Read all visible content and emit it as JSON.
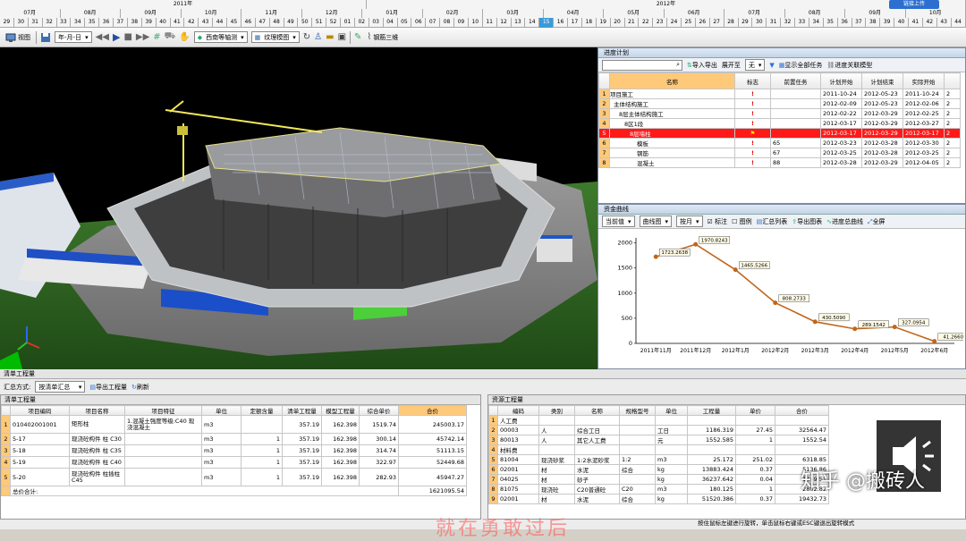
{
  "timeline": {
    "years": [
      {
        "label": "2011年"
      },
      {
        "label": "2012年"
      }
    ],
    "months": [
      "07月",
      "08月",
      "09月",
      "10月",
      "11月",
      "12月",
      "01月",
      "02月",
      "03月",
      "04月",
      "05月",
      "06月",
      "07月",
      "08月",
      "09月",
      "10月"
    ],
    "weeks": [
      "29",
      "30",
      "31",
      "32",
      "33",
      "34",
      "35",
      "36",
      "37",
      "38",
      "39",
      "40",
      "41",
      "42",
      "43",
      "44",
      "45",
      "46",
      "47",
      "48",
      "49",
      "50",
      "51",
      "52",
      "01",
      "02",
      "03",
      "04",
      "05",
      "06",
      "07",
      "08",
      "09",
      "10",
      "11",
      "12",
      "13",
      "14",
      "15",
      "16",
      "17",
      "18",
      "19",
      "20",
      "21",
      "22",
      "23",
      "24",
      "25",
      "26",
      "27",
      "28",
      "29",
      "30",
      "31",
      "32",
      "33",
      "34",
      "35",
      "36",
      "37",
      "38",
      "39",
      "40",
      "41",
      "42",
      "43",
      "44"
    ],
    "share_label": "链接上传"
  },
  "toolbar": {
    "view_label": "视图",
    "date_format": "年-月-日",
    "view_mode": "西南等轴测",
    "render_mode": "纹理模图",
    "steel_label": "钢筋三维"
  },
  "schedule": {
    "title": "进度计划",
    "search_placeholder": "",
    "import_export": "导入导出",
    "expand_label": "展开至",
    "expand_value": "无",
    "show_all": "显示全部任务",
    "link_model": "进度关联模型",
    "columns": [
      "",
      "名称",
      "标志",
      "前置任务",
      "计划开始",
      "计划结束",
      "实际开始",
      ""
    ],
    "rows": [
      {
        "no": "1",
        "name": "项目施工",
        "flag": "!",
        "pred": "",
        "ps": "2011-10-24",
        "pe": "2012-05-23",
        "as": "2011-10-24",
        "x": "2"
      },
      {
        "no": "2",
        "name": "主体结构施工",
        "flag": "!",
        "pred": "",
        "ps": "2012-02-09",
        "pe": "2012-05-23",
        "as": "2012-02-06",
        "x": "2"
      },
      {
        "no": "3",
        "name": "8层主体结构施工",
        "flag": "!",
        "pred": "",
        "ps": "2012-02-22",
        "pe": "2012-03-29",
        "as": "2012-02-25",
        "x": "2"
      },
      {
        "no": "4",
        "name": "8区1段",
        "flag": "!",
        "pred": "",
        "ps": "2012-03-17",
        "pe": "2012-03-29",
        "as": "2012-03-27",
        "x": "2"
      },
      {
        "no": "5",
        "name": "8层墙柱",
        "flag": "⚑",
        "pred": "",
        "ps": "2012-03-17",
        "pe": "2012-03-29",
        "as": "2012-03-17",
        "x": "2"
      },
      {
        "no": "6",
        "name": "模板",
        "flag": "!",
        "pred": "65",
        "ps": "2012-03-23",
        "pe": "2012-03-28",
        "as": "2012-03-30",
        "x": "2"
      },
      {
        "no": "7",
        "name": "钢筋",
        "flag": "!",
        "pred": "67",
        "ps": "2012-03-25",
        "pe": "2012-03-28",
        "as": "2012-03-25",
        "x": "2"
      },
      {
        "no": "8",
        "name": "混凝土",
        "flag": "!",
        "pred": "88",
        "ps": "2012-03-28",
        "pe": "2012-03-29",
        "as": "2012-04-05",
        "x": "2"
      }
    ]
  },
  "funds": {
    "title": "资金曲线",
    "mode": "当前值",
    "curve_type": "曲线图",
    "period": "按月",
    "check_label": "标注",
    "legend_label": "图例",
    "summary_label": "汇总列表",
    "export_chart": "导出图表",
    "progress_curve": "进度总曲线",
    "fullscreen": "全屏"
  },
  "chart_data": {
    "type": "line",
    "title": "",
    "xlabel": "",
    "ylabel": "",
    "categories": [
      "2011年11月",
      "2011年12月",
      "2012年1月",
      "2012年2月",
      "2012年3月",
      "2012年4月",
      "2012年5月",
      "2012年6月"
    ],
    "x": [
      0,
      0.5,
      1,
      2,
      3,
      4,
      5,
      5.5,
      6,
      7
    ],
    "series": [
      {
        "values": [
          1723.2638,
          1970.8243,
          1465.5266,
          808.2733,
          430.509,
          289.1542,
          327.0954,
          41.266
        ]
      }
    ],
    "point_x": [
      0.3,
      1.3,
      2.3,
      3.3,
      4.3,
      5.3,
      6.3,
      7.3
    ],
    "labels": [
      "1723.2638",
      "1970.8243",
      "1465.5266",
      "808.2733",
      "430.5090",
      "289.1542",
      "327.0954",
      "41.2660"
    ],
    "yticks": [
      "0",
      "500",
      "1000",
      "1500",
      "2000"
    ],
    "ylim": [
      0,
      2100
    ],
    "grid": false,
    "line_color": "#c0661b"
  },
  "bill": {
    "title": "清单工程量",
    "summary_mode_label": "汇总方式:",
    "summary_mode": "按清单汇总",
    "export_label": "导出工程量",
    "refresh_label": "刷新",
    "columns": [
      "",
      "项目编码",
      "项目名称",
      "项目特征",
      "单位",
      "定额含量",
      "清单工程量",
      "模型工程量",
      "综合单价",
      "合价"
    ],
    "rows": [
      {
        "no": "1",
        "code": "010402001001",
        "name": "矩形柱",
        "feat": "1.混凝土强度等级:C40 现浇混凝土",
        "unit": "m3",
        "q": "",
        "bq": "357.19",
        "mq": "162.398",
        "price": "1519.74",
        "total": "245003.17"
      },
      {
        "no": "2",
        "code": "5-17",
        "name": "现浇砼构件 柱 C30",
        "feat": "",
        "unit": "m3",
        "q": "1",
        "bq": "357.19",
        "mq": "162.398",
        "price": "300.14",
        "total": "45742.14"
      },
      {
        "no": "3",
        "code": "5-18",
        "name": "现浇砼构件 柱 C35",
        "feat": "",
        "unit": "m3",
        "q": "1",
        "bq": "357.19",
        "mq": "162.398",
        "price": "314.74",
        "total": "51113.15"
      },
      {
        "no": "4",
        "code": "5-19",
        "name": "现浇砼构件 柱 C40",
        "feat": "",
        "unit": "m3",
        "q": "1",
        "bq": "357.19",
        "mq": "162.398",
        "price": "322.97",
        "total": "52449.68"
      },
      {
        "no": "5",
        "code": "5-20",
        "name": "现浇砼构件 柱插柱 C45",
        "feat": "",
        "unit": "m3",
        "q": "1",
        "bq": "357.19",
        "mq": "162.398",
        "price": "282.93",
        "total": "45947.27"
      }
    ],
    "total_label": "总价合计:",
    "total_value": "1621095.54"
  },
  "resource": {
    "title": "资源工程量",
    "columns": [
      "",
      "编码",
      "类别",
      "名称",
      "规格型号",
      "单位",
      "工程量",
      "单价",
      "合价"
    ],
    "rows": [
      {
        "no": "1",
        "code": "人工费",
        "type": "",
        "name": "",
        "spec": "",
        "unit": "",
        "qty": "",
        "price": "",
        "total": ""
      },
      {
        "no": "2",
        "code": "00003",
        "type": "人",
        "name": "综合工日",
        "spec": "",
        "unit": "工日",
        "qty": "1186.319",
        "price": "27.45",
        "total": "32564.47"
      },
      {
        "no": "3",
        "code": "80013",
        "type": "人",
        "name": "其它人工费",
        "spec": "",
        "unit": "元",
        "qty": "1552.585",
        "price": "1",
        "total": "1552.54"
      },
      {
        "no": "4",
        "code": "材料费",
        "type": "",
        "name": "",
        "spec": "",
        "unit": "",
        "qty": "",
        "price": "",
        "total": ""
      },
      {
        "no": "5",
        "code": "81004",
        "type": "现浇砂浆",
        "name": "1:2水泥砂浆",
        "spec": "1:2",
        "unit": "m3",
        "qty": "25.172",
        "price": "251.02",
        "total": "6318.85"
      },
      {
        "no": "6",
        "code": "02001",
        "type": "材",
        "name": "水泥",
        "spec": "综合",
        "unit": "kg",
        "qty": "13883.424",
        "price": "0.37",
        "total": "5136.86"
      },
      {
        "no": "7",
        "code": "04025",
        "type": "材",
        "name": "砂子",
        "spec": "",
        "unit": "kg",
        "qty": "36237.642",
        "price": "0.04",
        "total": "1449.51"
      },
      {
        "no": "8",
        "code": "81075",
        "type": "现浇砼",
        "name": "C20普通砼",
        "spec": "C20",
        "unit": "m3",
        "qty": "180.125",
        "price": "1",
        "total": "2802.82"
      },
      {
        "no": "9",
        "code": "02001",
        "type": "材",
        "name": "水泥",
        "spec": "综合",
        "unit": "kg",
        "qty": "51520.386",
        "price": "0.37",
        "total": "19432.73"
      }
    ]
  },
  "status": {
    "hint": "按住鼠标左键进行旋转，单击鼠标右键或ESC键退出旋转模式"
  },
  "watermark": {
    "text": "知乎 @搬砖人"
  },
  "overlay": {
    "text": "就在勇敢过后"
  }
}
